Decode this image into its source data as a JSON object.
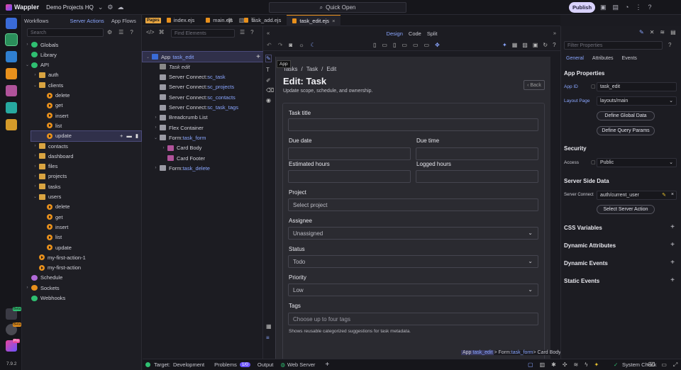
{
  "app": {
    "name": "Wappler",
    "project": "Demo Projects HQ",
    "quick_open": "Quick Open",
    "publish": "Publish",
    "version": "7.9.2"
  },
  "workflows": {
    "tabs": [
      {
        "label": "Workflows"
      },
      {
        "label": "Server Actions"
      },
      {
        "label": "App Flows"
      }
    ],
    "search_placeholder": "Search",
    "tree": [
      {
        "label": "Globals",
        "kind": "globe",
        "depth": 0,
        "chev": "›"
      },
      {
        "label": "Library",
        "kind": "lib",
        "depth": 0,
        "chev": ""
      },
      {
        "label": "API",
        "kind": "api",
        "depth": 0,
        "chev": "⌄"
      },
      {
        "label": "auth",
        "kind": "folder",
        "depth": 1,
        "chev": "›"
      },
      {
        "label": "clients",
        "kind": "folder",
        "depth": 1,
        "chev": "⌄"
      },
      {
        "label": "delete",
        "kind": "action",
        "depth": 2,
        "chev": ""
      },
      {
        "label": "get",
        "kind": "action",
        "depth": 2,
        "chev": ""
      },
      {
        "label": "insert",
        "kind": "action",
        "depth": 2,
        "chev": ""
      },
      {
        "label": "list",
        "kind": "action",
        "depth": 2,
        "chev": ""
      },
      {
        "label": "update",
        "kind": "action",
        "depth": 2,
        "chev": "",
        "selected": true
      },
      {
        "label": "contacts",
        "kind": "folder",
        "depth": 1,
        "chev": "›"
      },
      {
        "label": "dashboard",
        "kind": "folder",
        "depth": 1,
        "chev": "›"
      },
      {
        "label": "files",
        "kind": "folder",
        "depth": 1,
        "chev": "›"
      },
      {
        "label": "projects",
        "kind": "folder",
        "depth": 1,
        "chev": "›"
      },
      {
        "label": "tasks",
        "kind": "folder",
        "depth": 1,
        "chev": "›"
      },
      {
        "label": "users",
        "kind": "folder",
        "depth": 1,
        "chev": "⌄"
      },
      {
        "label": "delete",
        "kind": "action",
        "depth": 2,
        "chev": ""
      },
      {
        "label": "get",
        "kind": "action",
        "depth": 2,
        "chev": ""
      },
      {
        "label": "insert",
        "kind": "action",
        "depth": 2,
        "chev": ""
      },
      {
        "label": "list",
        "kind": "action",
        "depth": 2,
        "chev": ""
      },
      {
        "label": "update",
        "kind": "action",
        "depth": 2,
        "chev": ""
      },
      {
        "label": "my-first-action-1",
        "kind": "action",
        "depth": 1,
        "chev": ""
      },
      {
        "label": "my-first-action",
        "kind": "action",
        "depth": 1,
        "chev": ""
      },
      {
        "label": "Schedule",
        "kind": "schedule",
        "depth": 0,
        "chev": ""
      },
      {
        "label": "Sockets",
        "kind": "sockets",
        "depth": 0,
        "chev": "›"
      },
      {
        "label": "Webhooks",
        "kind": "webhooks",
        "depth": 0,
        "chev": ""
      }
    ]
  },
  "structure": {
    "pages_badge": "Pages",
    "find_placeholder": "Find Elements",
    "tree": [
      {
        "label": "App",
        "suffix": "task_edit",
        "depth": 0,
        "chev": "⌄",
        "kind": "app",
        "selected": true
      },
      {
        "label": "Task edit",
        "suffix": "",
        "depth": 1,
        "chev": "",
        "kind": "italic"
      },
      {
        "label": "Server Connect: ",
        "suffix": "sc_task",
        "depth": 1,
        "chev": "",
        "kind": "sc"
      },
      {
        "label": "Server Connect: ",
        "suffix": "sc_projects",
        "depth": 1,
        "chev": "",
        "kind": "sc"
      },
      {
        "label": "Server Connect: ",
        "suffix": "sc_contacts",
        "depth": 1,
        "chev": "",
        "kind": "sc"
      },
      {
        "label": "Server Connect: ",
        "suffix": "sc_task_tags",
        "depth": 1,
        "chev": "",
        "kind": "sc"
      },
      {
        "label": "Breadcrumb List",
        "suffix": "",
        "depth": 1,
        "chev": "›",
        "kind": "crumb"
      },
      {
        "label": "Flex Container",
        "suffix": "",
        "depth": 1,
        "chev": "›",
        "kind": "flex"
      },
      {
        "label": "Form: ",
        "suffix": "task_form",
        "depth": 1,
        "chev": "⌄",
        "kind": "form"
      },
      {
        "label": "Card Body",
        "suffix": "",
        "depth": 2,
        "chev": "›",
        "kind": "card"
      },
      {
        "label": "Card Footer",
        "suffix": "",
        "depth": 2,
        "chev": "",
        "kind": "card"
      },
      {
        "label": "Form: ",
        "suffix": "task_delete",
        "depth": 1,
        "chev": "›",
        "kind": "form"
      }
    ]
  },
  "file_tabs": [
    {
      "label": "index.ejs"
    },
    {
      "label": "main.ejs"
    },
    {
      "label": "task_add.ejs"
    },
    {
      "label": "task_edit.ejs",
      "active": true
    }
  ],
  "view_modes": {
    "design": "Design",
    "code": "Code",
    "split": "Split"
  },
  "tooltip": "App",
  "canvas": {
    "breadcrumb": [
      "Tasks",
      "/",
      "Task",
      "/",
      "Edit"
    ],
    "title": "Edit: Task",
    "subtitle": "Update scope, schedule, and ownership.",
    "back": "Back",
    "fields": {
      "task_title": "Task title",
      "due_date": "Due date",
      "due_time": "Due time",
      "est_hours": "Estimated hours",
      "logged_hours": "Logged hours",
      "project": "Project",
      "project_ph": "Select project",
      "assignee": "Assignee",
      "assignee_val": "Unassigned",
      "status": "Status",
      "status_val": "Todo",
      "priority": "Priority",
      "priority_val": "Low",
      "tags": "Tags",
      "tags_ph": "Choose up to four tags",
      "tags_help": "Shows reusable categorized suggestions for task metadata."
    }
  },
  "canvas_path": {
    "app": "App",
    "app_id": "task_edit",
    "sep1": " > Form: ",
    "form": "task_form",
    "sep2": " > Card Body"
  },
  "props": {
    "filter_placeholder": "Filter Properties",
    "tabs": [
      {
        "label": "General",
        "active": true
      },
      {
        "label": "Attributes"
      },
      {
        "label": "Events"
      }
    ],
    "app_props": "App Properties",
    "app_id_label": "App ID",
    "app_id": "task_edit",
    "layout_label": "Layout Page",
    "layout": "layouts/main",
    "define_global": "Define Global Data",
    "define_query": "Define Query Params",
    "security": "Security",
    "access_label": "Access",
    "access": "Public",
    "ssd": "Server Side Data",
    "sc_label": "Server Connect",
    "sc_value": "auth/current_user",
    "select_action": "Select Server Action",
    "sections": [
      {
        "label": "CSS Variables"
      },
      {
        "label": "Dynamic Attributes"
      },
      {
        "label": "Dynamic Events"
      },
      {
        "label": "Static Events"
      }
    ]
  },
  "status": {
    "target_label": "Target:",
    "target": "Development",
    "problems": "Problems",
    "problems_count": "1/0",
    "output": "Output",
    "web_server": "Web Server",
    "system_check": "System Check"
  },
  "badges": {
    "beta1": "Beta",
    "beta2": "Beta",
    "pro": "Pro"
  },
  "colors": {
    "accent": "#8aa6ff",
    "orange": "#e8901c",
    "green": "#2fbf71",
    "bg": "#1b1b21"
  }
}
